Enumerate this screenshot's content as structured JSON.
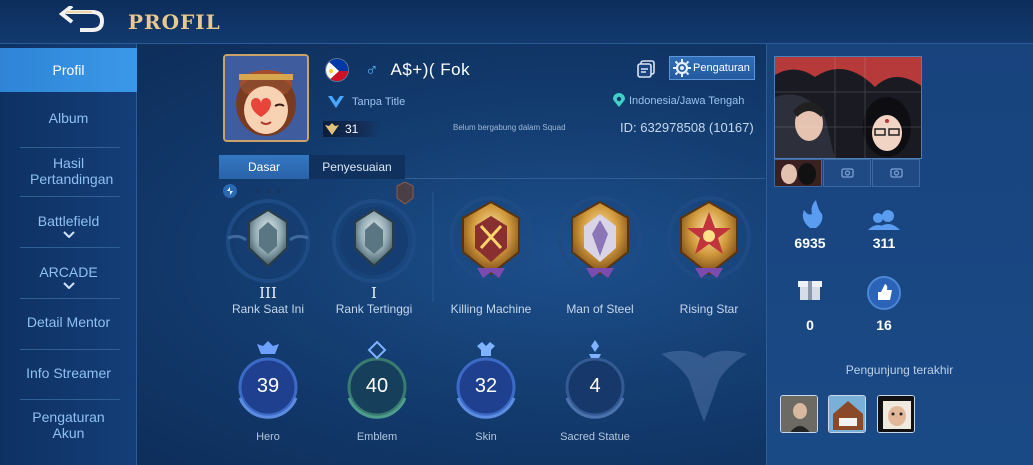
{
  "header": {
    "title": "PROFIL",
    "back_icon": "back-arrow-icon"
  },
  "sidebar": {
    "items": [
      {
        "label": "Profil",
        "active": true
      },
      {
        "label": "Album"
      },
      {
        "label": "Hasil Pertandingan"
      },
      {
        "label": "Battlefield",
        "expandable": true
      },
      {
        "label": "ARCADE",
        "expandable": true
      },
      {
        "label": "Detail Mentor"
      },
      {
        "label": "Info Streamer"
      },
      {
        "label": "Pengaturan Akun"
      }
    ]
  },
  "profile": {
    "name": "A$+)( Fok",
    "gender_icon": "male-icon",
    "title": "Tanpa Title",
    "level": "31",
    "squad": "Belum bergabung dalam Squad",
    "settings_label": "Pengaturan",
    "location": "Indonesia/Jawa Tengah",
    "id": "ID: 632978508 (10167)"
  },
  "tabs": [
    {
      "label": "Dasar",
      "active": true
    },
    {
      "label": "Penyesuaian",
      "active": false
    }
  ],
  "ranks": [
    {
      "roman": "III",
      "label": "Rank Saat Ini"
    },
    {
      "roman": "I",
      "label": "Rank Tertinggi"
    },
    {
      "roman": "",
      "label": "Killing Machine"
    },
    {
      "roman": "",
      "label": "Man of Steel"
    },
    {
      "roman": "",
      "label": "Rising Star"
    }
  ],
  "stats": [
    {
      "value": "39",
      "label": "Hero"
    },
    {
      "value": "40",
      "label": "Emblem"
    },
    {
      "value": "32",
      "label": "Skin"
    },
    {
      "value": "4",
      "label": "Sacred Statue"
    }
  ],
  "popularity": {
    "fire": "6935",
    "friends": "311",
    "gifts": "0",
    "likes": "16"
  },
  "visitors_label": "Pengunjung terakhir",
  "colors": {
    "gold": "#e9c98d",
    "accent": "#3b98e8",
    "text_blue": "#8fc0f3"
  }
}
